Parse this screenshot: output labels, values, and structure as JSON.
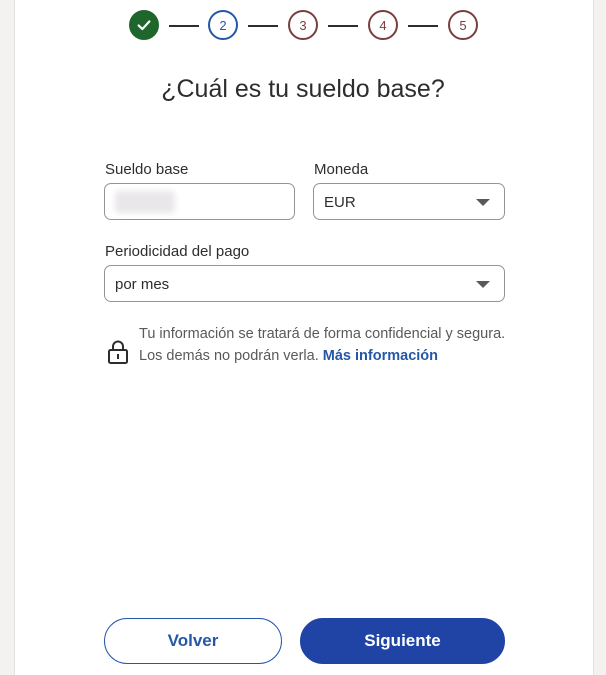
{
  "stepper": {
    "steps": [
      {
        "label": "",
        "state": "done",
        "icon": "check-icon"
      },
      {
        "label": "2",
        "state": "active"
      },
      {
        "label": "3",
        "state": "todo"
      },
      {
        "label": "4",
        "state": "todo"
      },
      {
        "label": "5",
        "state": "todo"
      }
    ]
  },
  "page": {
    "title": "¿Cuál es tu sueldo base?"
  },
  "form": {
    "salary_label": "Sueldo base",
    "salary_value": "",
    "currency_label": "Moneda",
    "currency_value": "EUR",
    "period_label": "Periodicidad del pago",
    "period_value": "por mes"
  },
  "notice": {
    "text": "Tu información se tratará de forma confidencial y segura. Los demás no podrán verla.",
    "link": "Más información",
    "icon": "lock-icon"
  },
  "buttons": {
    "back": "Volver",
    "next": "Siguiente"
  },
  "colors": {
    "accent": "#2557a7",
    "primary_button": "#2043a6",
    "done_step": "#1f662c",
    "pending_step": "#7a3e3e"
  }
}
